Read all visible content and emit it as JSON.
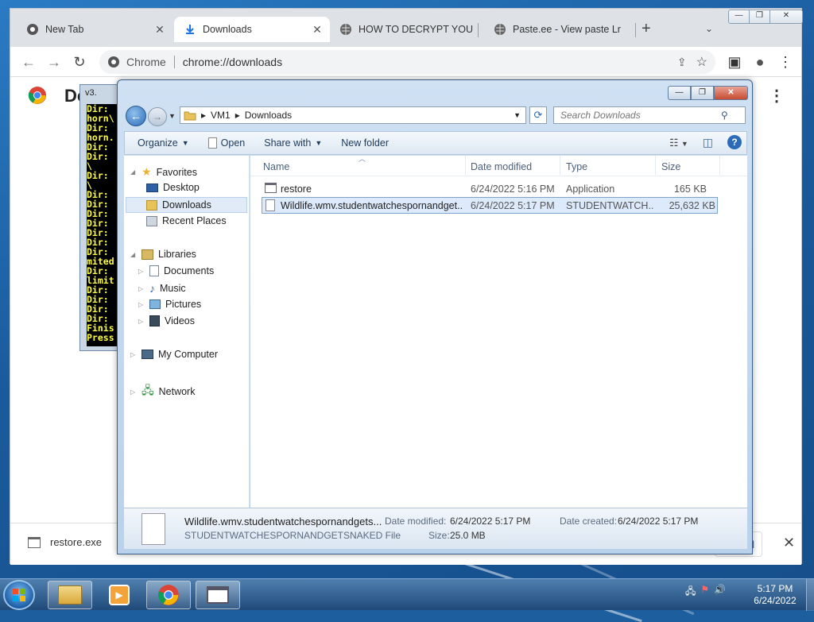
{
  "browser": {
    "tabs": [
      {
        "title": "New Tab",
        "icon": "chrome-icon"
      },
      {
        "title": "Downloads",
        "icon": "download-icon"
      },
      {
        "title": "HOW TO DECRYPT YOU",
        "icon": "globe-icon"
      },
      {
        "title": "Paste.ee - View paste Lr",
        "icon": "globe-icon"
      }
    ],
    "omnibox_chip": "Chrome",
    "url": "chrome://downloads",
    "page_title": "Do",
    "shelf_filename": "restore.exe",
    "shelf_showall": "all"
  },
  "cmd": {
    "title": "v3.",
    "lines": [
      "Dir:",
      "horn\\",
      "Dir:",
      "horn.",
      "Dir:",
      "Dir:",
      "\\",
      "Dir:",
      "\\",
      "Dir:",
      "Dir:",
      "Dir:",
      "Dir:",
      "Dir:",
      "Dir:",
      "Dir:",
      "mited",
      "Dir:",
      "limit",
      "Dir:",
      "Dir:",
      "Dir:",
      "Dir:",
      "Finis",
      "Press"
    ]
  },
  "explorer": {
    "breadcrumb": [
      "VM1",
      "Downloads"
    ],
    "search_placeholder": "Search Downloads",
    "commands": {
      "organize": "Organize",
      "open": "Open",
      "share_with": "Share with",
      "new_folder": "New folder"
    },
    "nav": {
      "favorites": "Favorites",
      "desktop": "Desktop",
      "downloads": "Downloads",
      "recent": "Recent Places",
      "libraries": "Libraries",
      "documents": "Documents",
      "music": "Music",
      "pictures": "Pictures",
      "videos": "Videos",
      "computer": "My Computer",
      "network": "Network"
    },
    "columns": {
      "name": "Name",
      "date": "Date modified",
      "type": "Type",
      "size": "Size"
    },
    "files": [
      {
        "name": "restore",
        "date": "6/24/2022 5:16 PM",
        "type": "Application",
        "size": "165 KB"
      },
      {
        "name": "Wildlife.wmv.studentwatchespornandget...",
        "date": "6/24/2022 5:17 PM",
        "type": "STUDENTWATCH...",
        "size": "25,632 KB"
      }
    ],
    "details": {
      "filename": "Wildlife.wmv.studentwatchespornandgets...",
      "filetype": "STUDENTWATCHESPORNANDGETSNAKED File",
      "modified_label": "Date modified:",
      "modified": "6/24/2022 5:17 PM",
      "created_label": "Date created:",
      "created": "6/24/2022 5:17 PM",
      "size_label": "Size:",
      "size": "25.0 MB"
    }
  },
  "taskbar": {
    "time": "5:17 PM",
    "date": "6/24/2022"
  },
  "colors": {
    "accent": "#1a73e8",
    "desktop": "#1a5a9c",
    "selection": "#dceafc"
  }
}
